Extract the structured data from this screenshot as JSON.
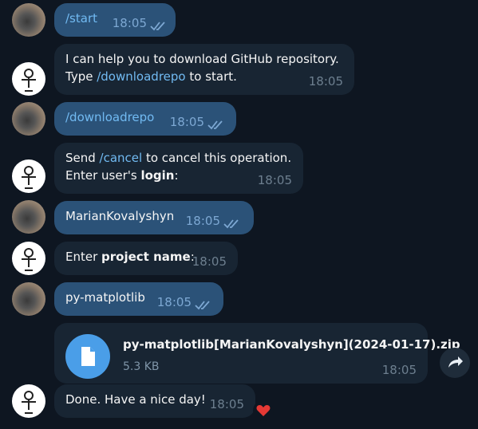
{
  "messages": [
    {
      "id": "m1",
      "from": "user",
      "text": "/start",
      "time": "18:05"
    },
    {
      "id": "m2",
      "from": "bot",
      "line1": "I can help you to download GitHub repository.",
      "line2_pre": "Type ",
      "line2_link": "/downloadrepo",
      "line2_post": " to start.",
      "time": "18:05"
    },
    {
      "id": "m3",
      "from": "user",
      "text": "/downloadrepo",
      "time": "18:05"
    },
    {
      "id": "m4",
      "from": "bot",
      "line1_pre": "Send ",
      "line1_link": "/cancel",
      "line1_post": " to cancel this operation.",
      "line2_pre": "Enter user's ",
      "line2_bold": "login",
      "line2_post": ":",
      "time": "18:05"
    },
    {
      "id": "m5",
      "from": "user",
      "text": "MarianKovalyshyn",
      "time": "18:05"
    },
    {
      "id": "m6",
      "from": "bot",
      "pre": "Enter ",
      "bold": "project name",
      "post": ":",
      "time": "18:05"
    },
    {
      "id": "m7",
      "from": "user",
      "text": "py-matplotlib",
      "time": "18:05"
    },
    {
      "id": "m8",
      "from": "bot",
      "file_name": "py-matplotlib[MarianKovalyshyn](2024-01-17).zip",
      "file_size": "5.3 KB",
      "time": "18:05"
    },
    {
      "id": "m9",
      "from": "bot",
      "text": "Done. Have a nice day!",
      "time": "18:05",
      "reaction": "heart"
    }
  ],
  "colors": {
    "background": "#0e1621",
    "outgoing": "#2b5278",
    "incoming": "#182533",
    "link": "#71baf2",
    "file_icon": "#4a9ee8"
  },
  "icons": {
    "read": "double-check-icon",
    "file": "document-icon",
    "share": "share-arrow-icon",
    "reaction": "heart-icon"
  }
}
